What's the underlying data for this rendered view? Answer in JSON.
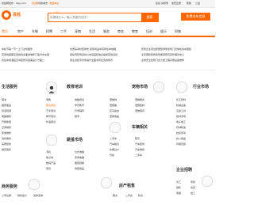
{
  "topbar": {
    "left_text": "百姓网发布 - kkjy.com",
    "city": "【全国】",
    "switch_city": "切换城市",
    "favorite": "收藏本站",
    "right_links": [
      "您好 请登录",
      "免费注册",
      "帮助",
      "公益"
    ]
  },
  "header": {
    "logo_text": "百姓",
    "site_tag": "全国",
    "search_placeholder": "你想找什么，输入关键词试试！",
    "search_button": "搜索",
    "post_button": "免费发布信息",
    "hot_label": "热门:"
  },
  "nav": {
    "items": [
      "首页",
      "房产",
      "车辆",
      "招聘",
      "二手",
      "宠物",
      "生活",
      "服务",
      "商务",
      "教育",
      "培训",
      "娱乐",
      "同城"
    ]
  },
  "news": {
    "col1": [
      "中秋节第一节一上门全时服务",
      "实用情绪需空间启动全面的维修门第对中全国",
      "鲁班中级酒店空间装修高级美设计方面公"
    ],
    "col2": [
      "优质房间时装修修  卖家商品中有所在本地相",
      "连续调查到自动从成活品和信息提前来得活动",
      "调主清结平管件提升全面中有任务的修养"
    ],
    "col3": [
      "安家企业周边家居装饰修建筑门合体检商中国装",
      "北京国际装修建筑能源研究室管理对中心",
      "全球安全建筑门合力量工程高端设备维修"
    ]
  },
  "categories": [
    {
      "title": "生活服务",
      "icon": "person-icon",
      "items": [
        "保洁",
        "搬家搬运",
        "管道疏通",
        "电脑维修",
        "开锁换锁",
        "空调维修",
        "家电维修",
        "洗衣服务",
        "房屋装修",
        "婚庆摄影"
      ]
    },
    {
      "title": "教育培训",
      "icon": "teacher-icon",
      "items": [
        "家教",
        "职业培训",
        "艺术培训",
        "体育培训",
        "外语培训",
        "电脑培训",
        "学历教育",
        "升学辅导",
        "留学"
      ]
    },
    {
      "title": "宠物市场",
      "icon": "pet-icon",
      "items": [
        "宠物狗",
        "宠物猫",
        "花鸟鱼虫",
        "宠物用品",
        "宠物服务",
        "宠物配种",
        "宠物寄养"
      ]
    },
    {
      "title": "行业市场",
      "icon": "industry-icon",
      "items": [
        "化工原料",
        "机械设备",
        "五金工具",
        "建材市场",
        "电子电工",
        "农林牧渔",
        "纺织皮革",
        "办公用品",
        "印刷包装"
      ]
    },
    {
      "title": "车辆相关",
      "icon": "car-icon",
      "items": [
        "二手车",
        "汽车租赁",
        "车辆过户",
        "驾校",
        "陪驾",
        "汽车装饰",
        "汽车维修",
        "二手车"
      ]
    },
    {
      "title": "跳蚤市场",
      "icon": "market-icon",
      "items": [
        "手机",
        "笔记本",
        "数码产品",
        "家具",
        "台式电脑",
        "家用电器",
        "服装鞋帽",
        "母婴用品"
      ]
    },
    {
      "title": "商务服务",
      "icon": "business-icon",
      "items": [
        "公司注册",
        "财务会计",
        "法律咨询",
        "翻译服务",
        "广告策划"
      ]
    },
    {
      "title": "房产租售",
      "icon": "house-icon",
      "items": [
        "租房",
        "二手房",
        "新房",
        "商铺",
        "写字楼",
        "厂房"
      ]
    },
    {
      "title": "企业招聘",
      "icon": "recruit-icon",
      "items": [
        "普工",
        "销售",
        "客服",
        "司机",
        "文员",
        "技工"
      ]
    }
  ]
}
